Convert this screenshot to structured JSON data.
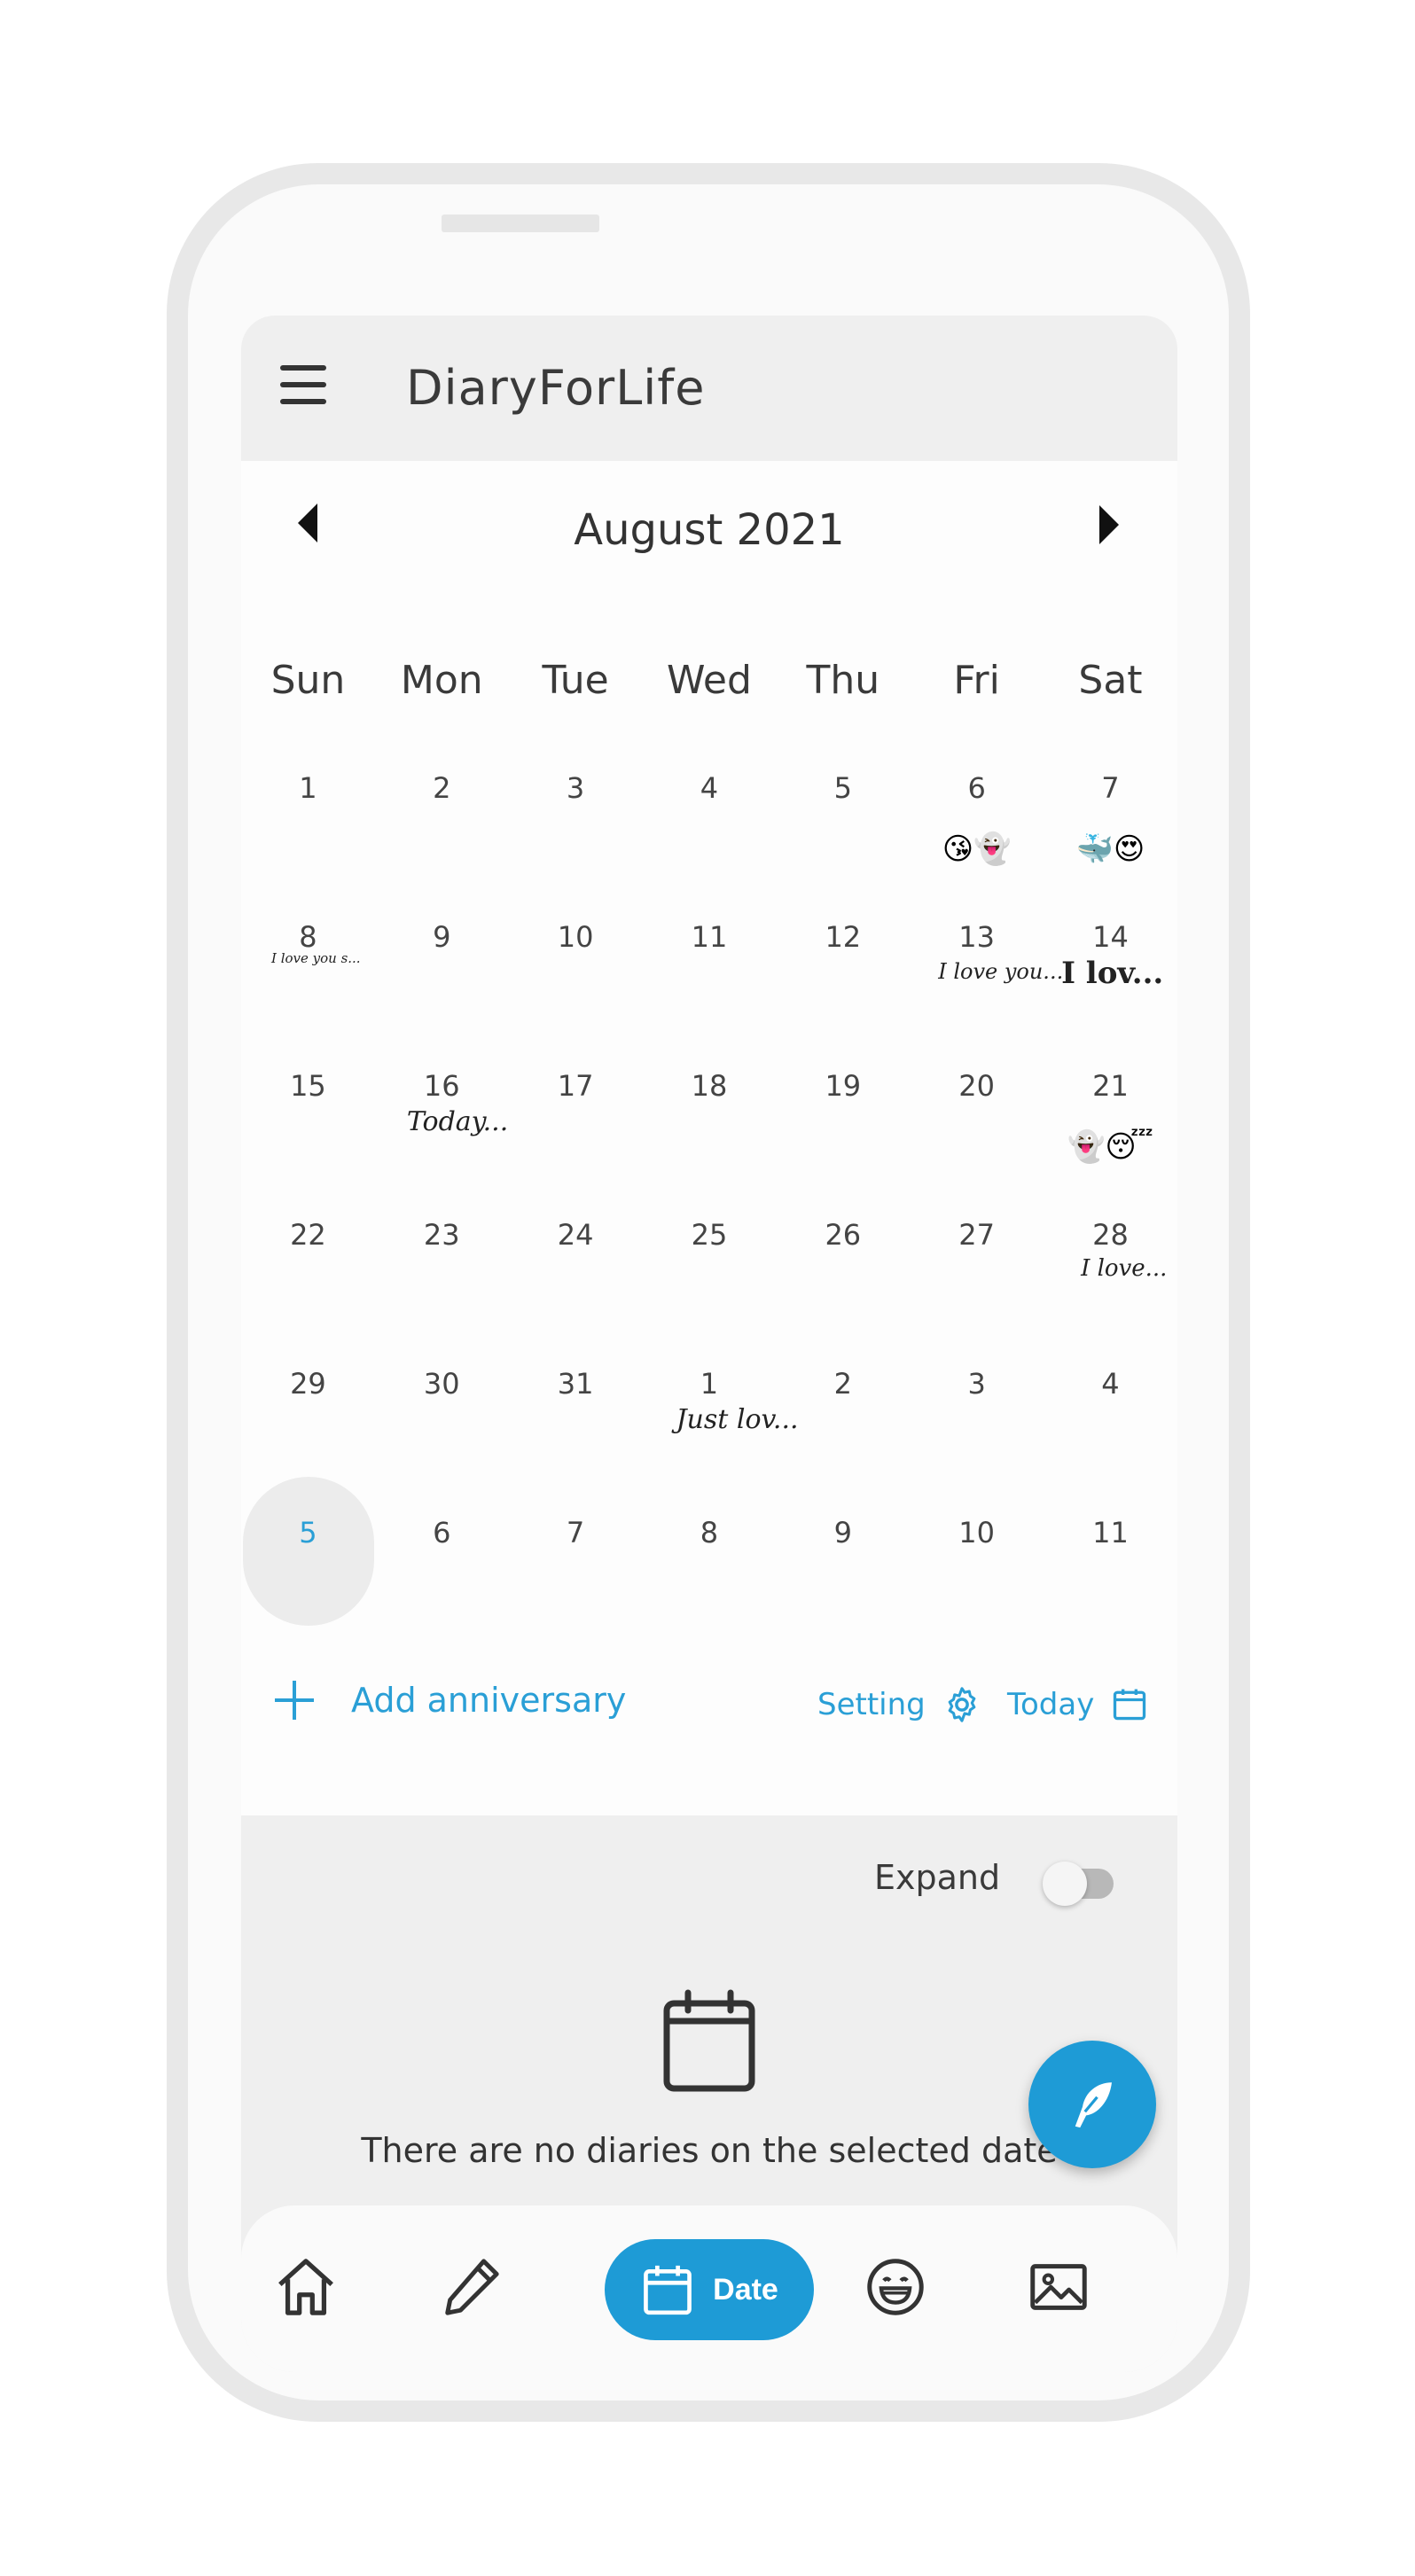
{
  "app": {
    "title": "DiaryForLife"
  },
  "calendar": {
    "month_label": "August 2021",
    "weekdays": [
      "Sun",
      "Mon",
      "Tue",
      "Wed",
      "Thu",
      "Fri",
      "Sat"
    ],
    "weeks": [
      [
        "1",
        "2",
        "3",
        "4",
        "5",
        "6",
        "7"
      ],
      [
        "8",
        "9",
        "10",
        "11",
        "12",
        "13",
        "14"
      ],
      [
        "15",
        "16",
        "17",
        "18",
        "19",
        "20",
        "21"
      ],
      [
        "22",
        "23",
        "24",
        "25",
        "26",
        "27",
        "28"
      ],
      [
        "29",
        "30",
        "31",
        "1",
        "2",
        "3",
        "4"
      ],
      [
        "5",
        "6",
        "7",
        "8",
        "9",
        "10",
        "11"
      ]
    ],
    "selected_day": "5",
    "emojis": {
      "fri_13": "😘👻",
      "sat_14": "🐳😍",
      "sat_28": "👻😴"
    },
    "notes": {
      "sun_8": "I love you s...",
      "fri_13": "I love you...",
      "sat_14": "I lov...",
      "mon_16": "Today...",
      "sat_28": "I love...",
      "wed_1": "Just lov..."
    }
  },
  "actions": {
    "add_anniversary": "Add anniversary",
    "setting": "Setting",
    "today": "Today"
  },
  "diary_panel": {
    "expand_label": "Expand",
    "expand_on": false,
    "empty_message": "There are no diaries on the selected date"
  },
  "nav": {
    "active_label": "Date",
    "items": [
      "home-icon",
      "pencil-icon",
      "calendar-icon",
      "smile-icon",
      "image-icon"
    ]
  },
  "colors": {
    "accent": "#1e9bd6",
    "appbar": "#efefef"
  }
}
